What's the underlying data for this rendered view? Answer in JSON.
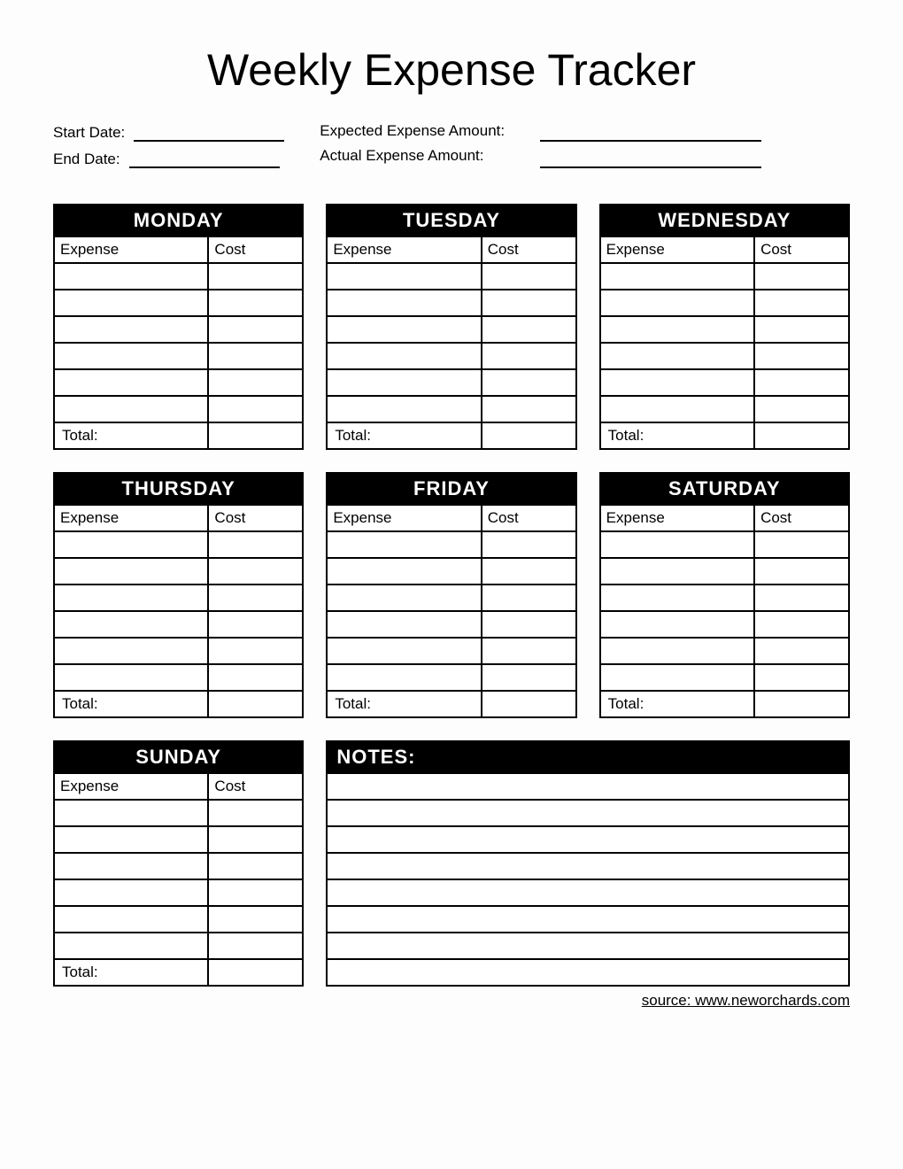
{
  "title": "Weekly Expense Tracker",
  "meta": {
    "start_date_label": "Start Date:",
    "end_date_label": "End Date:",
    "expected_label": "Expected Expense Amount:",
    "actual_label": "Actual Expense Amount:"
  },
  "columns": {
    "expense": "Expense",
    "cost": "Cost"
  },
  "total_label": "Total:",
  "days": [
    {
      "name": "MONDAY"
    },
    {
      "name": "TUESDAY"
    },
    {
      "name": "WEDNESDAY"
    },
    {
      "name": "THURSDAY"
    },
    {
      "name": "FRIDAY"
    },
    {
      "name": "SATURDAY"
    },
    {
      "name": "SUNDAY"
    }
  ],
  "notes_label": "NOTES:",
  "source": "source: www.neworchards.com"
}
